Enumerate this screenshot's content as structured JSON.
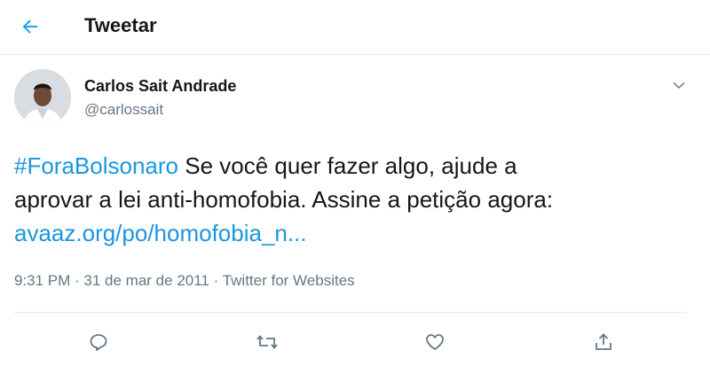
{
  "header": {
    "title": "Tweetar",
    "back_icon": "arrow-left-icon"
  },
  "author": {
    "name": "Carlos Sait Andrade",
    "handle": "@carlossait"
  },
  "tweet": {
    "hashtag": "#ForaBolsonaro",
    "text_line1": " Se você quer fazer algo, ajude a",
    "text_line2": "aprovar a lei anti-homofobia. Assine a petição agora:",
    "link": "avaaz.org/po/homofobia_n..."
  },
  "meta": {
    "time": "9:31 PM",
    "date": "31 de mar de 2011",
    "source": "Twitter for Websites",
    "separator": " · "
  },
  "actions": [
    "reply-icon",
    "retweet-icon",
    "like-icon",
    "share-icon"
  ],
  "colors": {
    "accent": "#1b95e0",
    "text": "#14171a",
    "secondary": "#657786",
    "divider": "#e6ecf0"
  }
}
